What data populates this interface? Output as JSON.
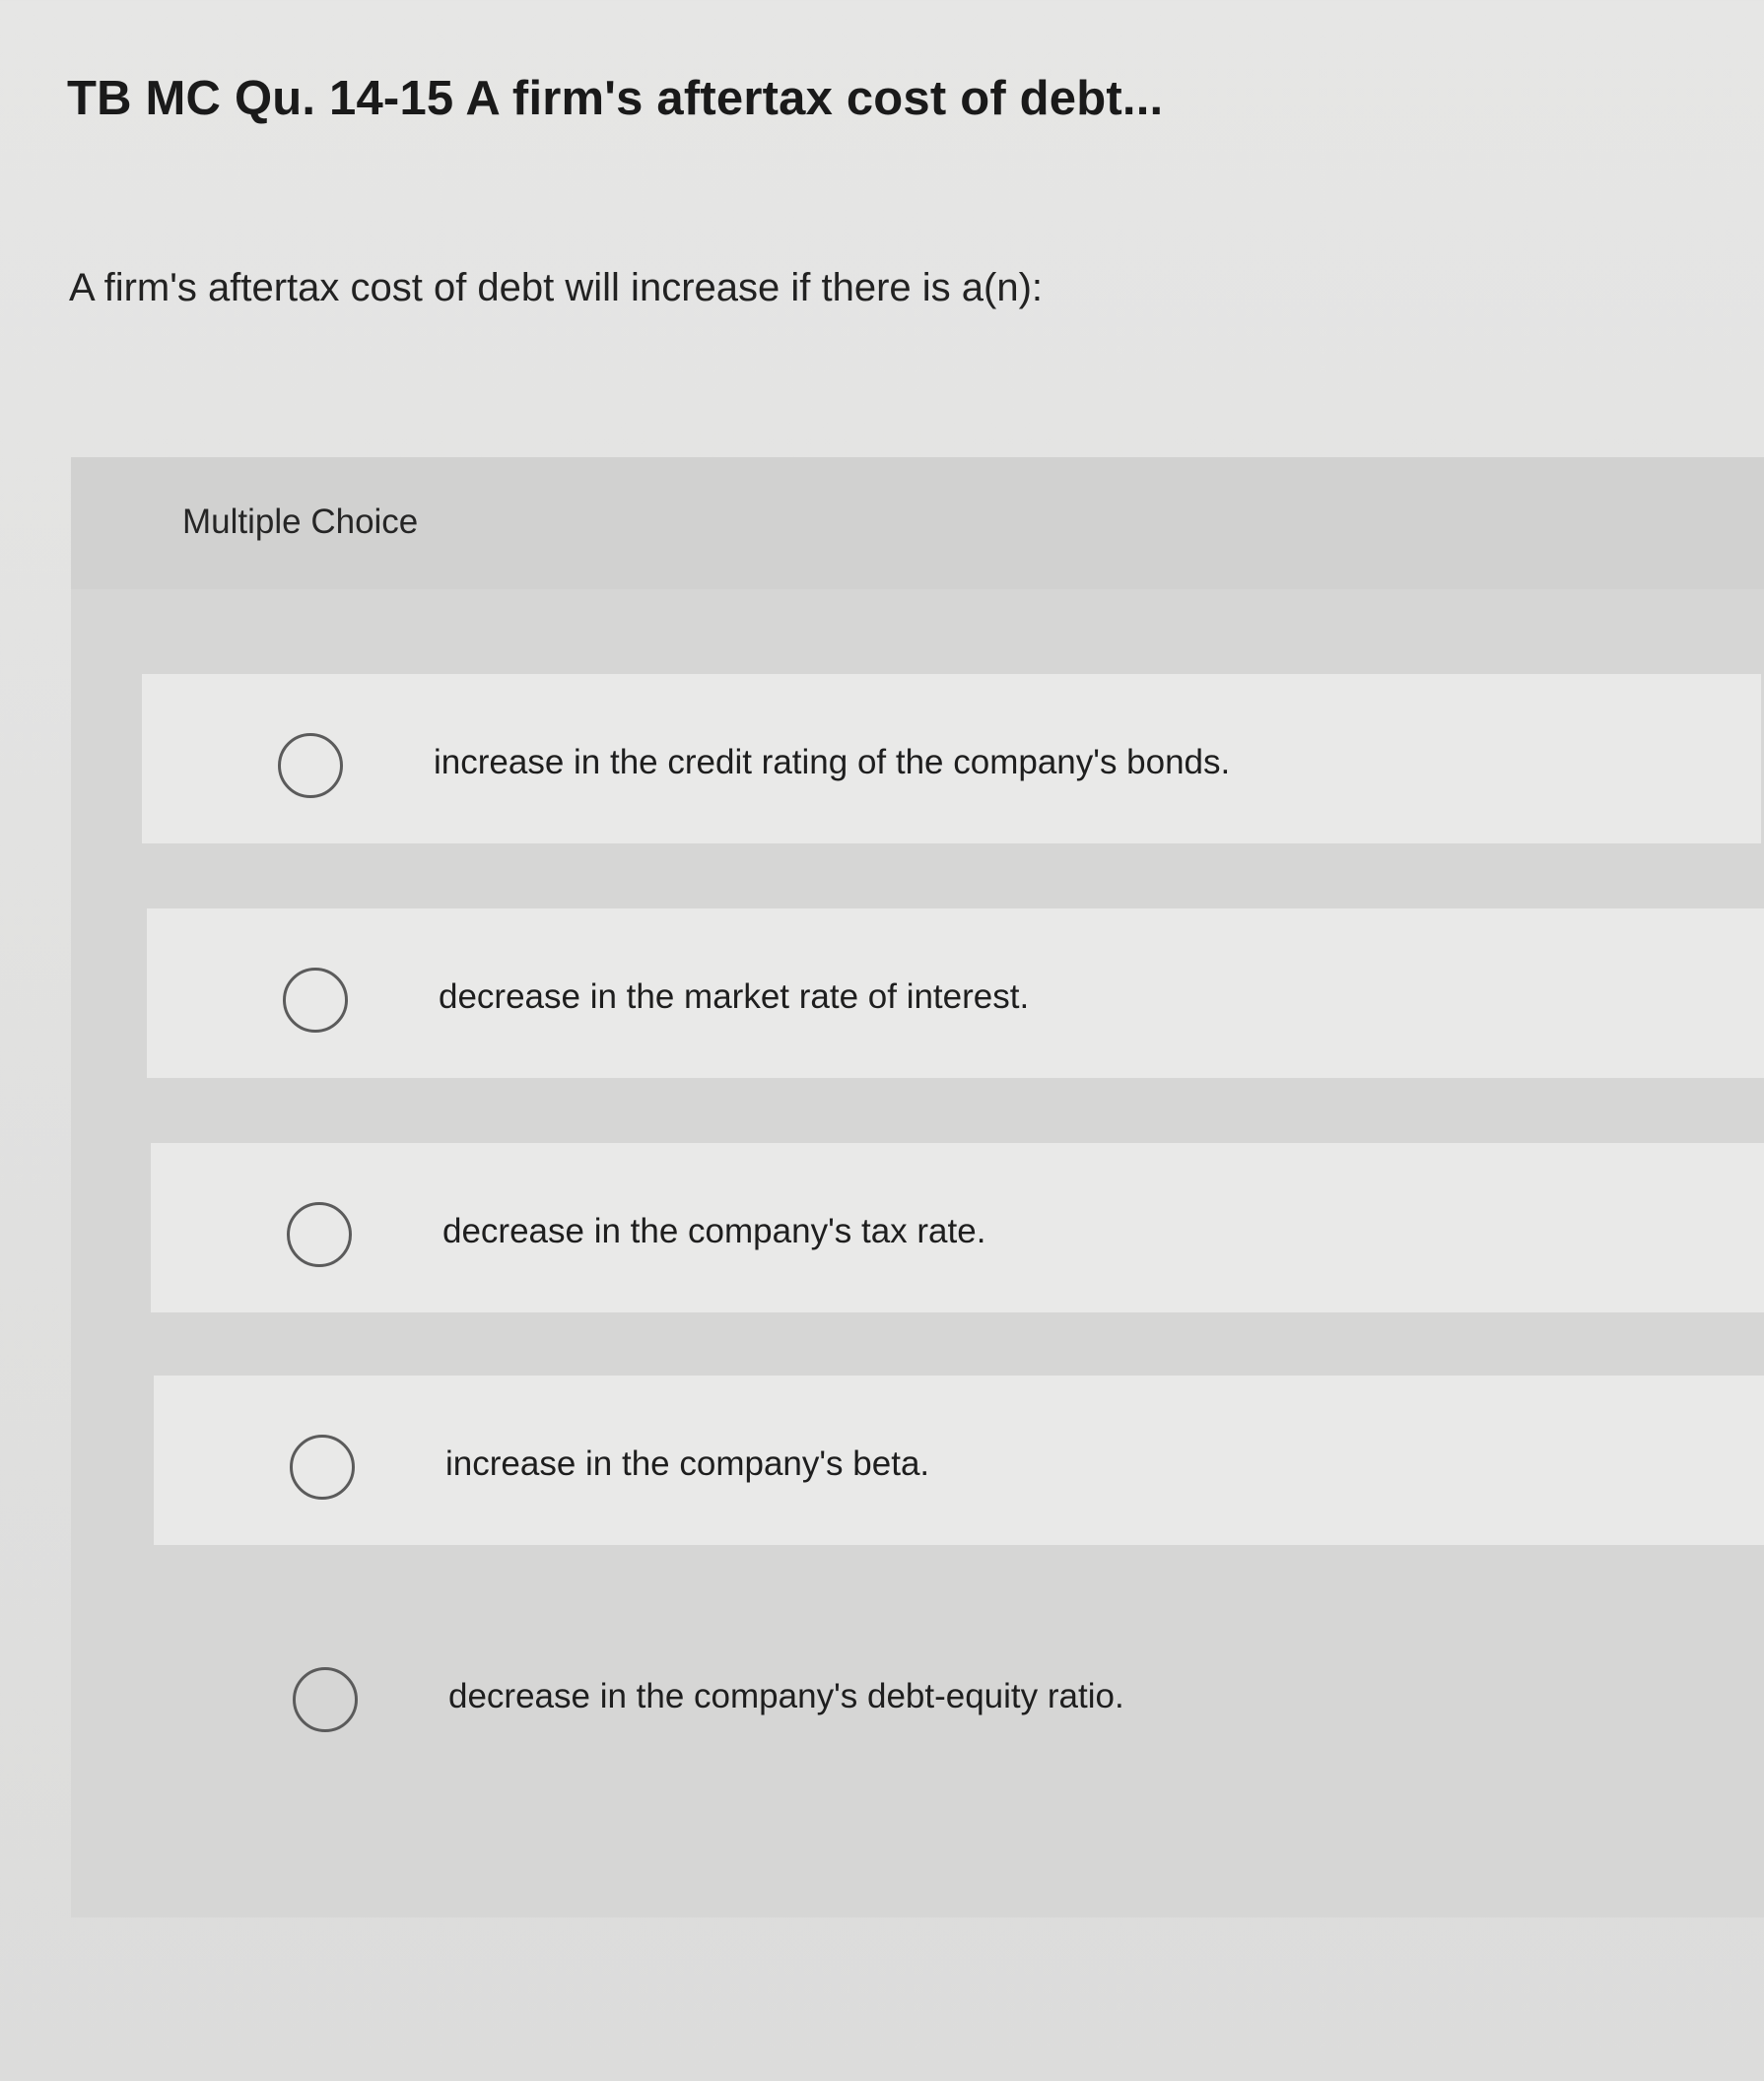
{
  "question": {
    "title": "TB MC Qu. 14-15 A firm's aftertax cost of debt...",
    "prompt": "A firm's aftertax cost of debt will increase if there is a(n):"
  },
  "multiple_choice": {
    "label": "Multiple Choice",
    "options": [
      {
        "text": "increase in the credit rating of the company's bonds.",
        "selected": false
      },
      {
        "text": "decrease in the market rate of interest.",
        "selected": false
      },
      {
        "text": "decrease in the company's tax rate.",
        "selected": false
      },
      {
        "text": "increase in the company's beta.",
        "selected": false
      },
      {
        "text": "decrease in the company's debt-equity ratio.",
        "selected": false
      }
    ]
  }
}
